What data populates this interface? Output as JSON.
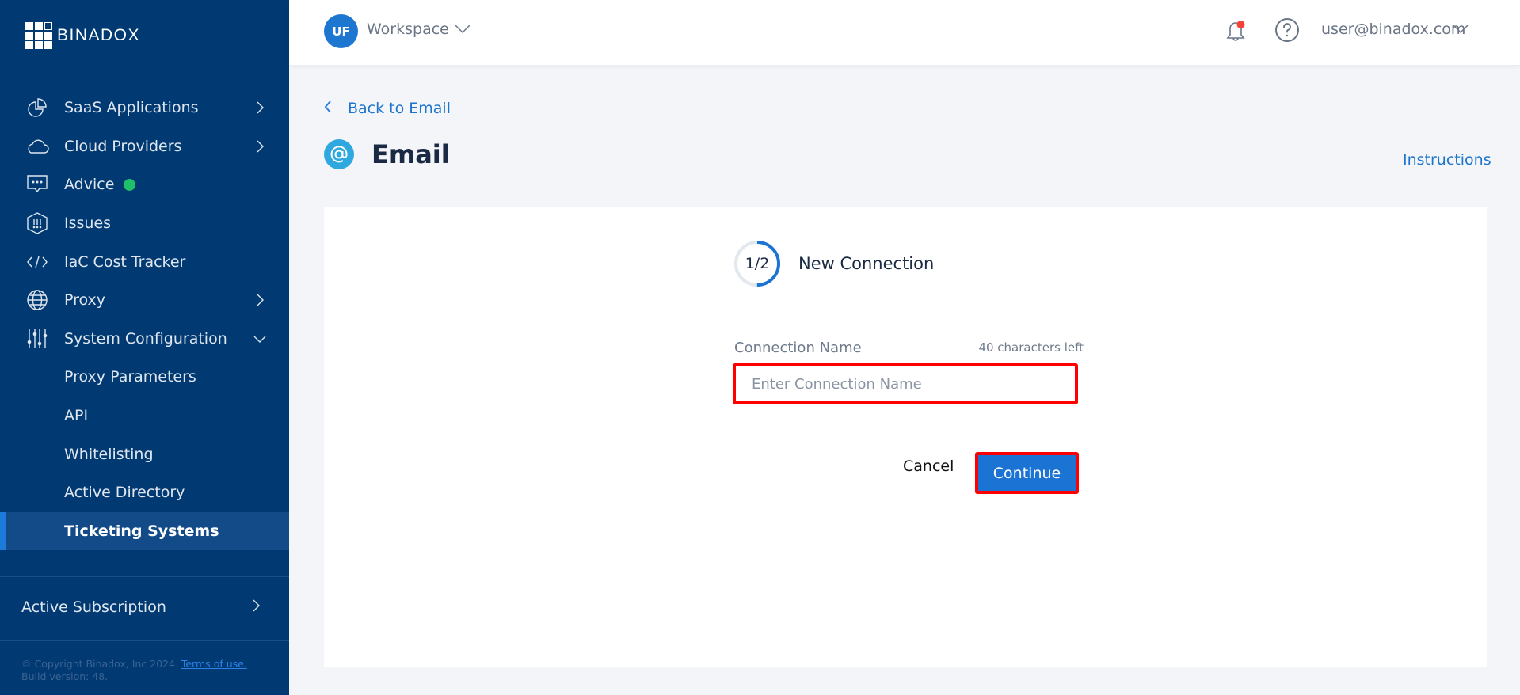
{
  "brand": {
    "name": "BINADOX"
  },
  "sidebar": {
    "items": [
      {
        "label": "SaaS Applications",
        "icon": "pie-chart-icon",
        "has_chevron": true
      },
      {
        "label": "Cloud Providers",
        "icon": "cloud-icon",
        "has_chevron": true
      },
      {
        "label": "Advice",
        "icon": "message-icon",
        "badge_color": "#1fc06a"
      },
      {
        "label": "Issues",
        "icon": "hexagon-alert-icon"
      },
      {
        "label": "IaC Cost Tracker",
        "icon": "code-icon"
      },
      {
        "label": "Proxy",
        "icon": "globe-icon",
        "has_chevron": true
      },
      {
        "label": "System Configuration",
        "icon": "sliders-icon",
        "expanded": true
      }
    ],
    "subitems": [
      {
        "label": "Proxy Parameters"
      },
      {
        "label": "API"
      },
      {
        "label": "Whitelisting"
      },
      {
        "label": "Active Directory"
      },
      {
        "label": "Ticketing Systems",
        "active": true
      }
    ],
    "subscription": {
      "label": "Active Subscription"
    },
    "footer": {
      "copyright": "© Copyright Binadox, Inc 2024.",
      "terms_link": "Terms of use.",
      "build": "Build version: 48."
    }
  },
  "header": {
    "workspace_initials": "UF",
    "workspace_name": "Workspace",
    "user_email": "user@binadox.com",
    "notification_dot_color": "#f44336"
  },
  "page": {
    "back_label": "Back to Email",
    "title": "Email",
    "instructions_label": "Instructions"
  },
  "wizard": {
    "step_text": "1/2",
    "step_progress": 0.5,
    "step_title": "New Connection",
    "field_label": "Connection Name",
    "char_count": "40 characters left",
    "field_placeholder": "Enter Connection Name",
    "field_value": "",
    "cancel_label": "Cancel",
    "continue_label": "Continue"
  },
  "colors": {
    "sidebar_bg": "#013a72",
    "accent": "#1b74d3",
    "highlight_border": "#ff0000"
  }
}
